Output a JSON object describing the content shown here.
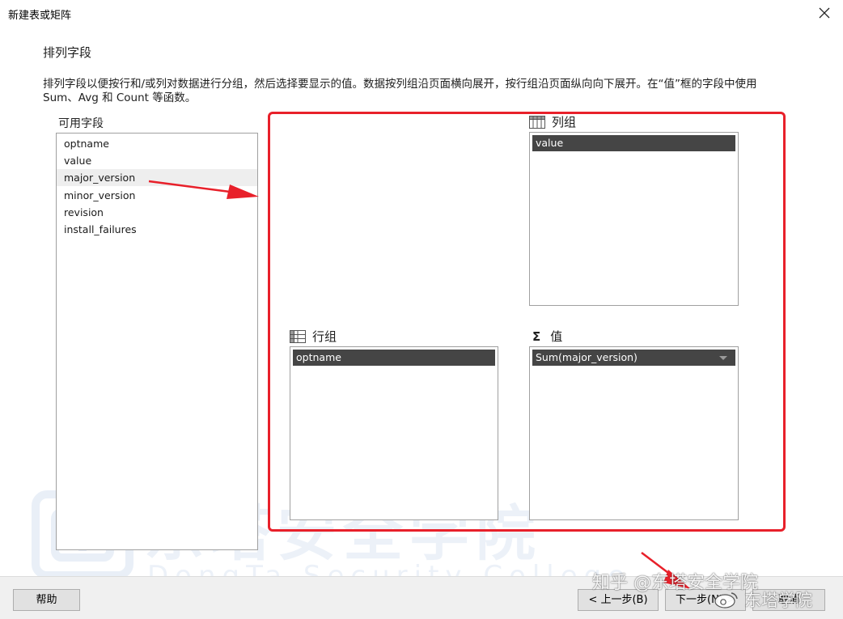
{
  "window": {
    "title": "新建表或矩阵"
  },
  "page": {
    "section_title": "排列字段",
    "description": "排列字段以便按行和/或列对数据进行分组，然后选择要显示的值。数据按列组沿页面横向展开，按行组沿页面纵向向下展开。在“值”框的字段中使用 Sum、Avg 和 Count 等函数。"
  },
  "available_fields": {
    "label": "可用字段",
    "items": [
      "optname",
      "value",
      "major_version",
      "minor_version",
      "revision",
      "install_failures"
    ]
  },
  "column_groups": {
    "label": "列组",
    "items": [
      "value"
    ]
  },
  "row_groups": {
    "label": "行组",
    "items": [
      "optname"
    ]
  },
  "values": {
    "label": "值",
    "symbol": "Σ",
    "items": [
      "Sum(major_version)"
    ]
  },
  "footer": {
    "help_label": "帮助",
    "back_label": "< 上一步(B)",
    "next_label": "下一步(N) >",
    "cancel_label": "取消"
  },
  "watermark": {
    "cn": "东塔安全学院",
    "en": "DongTa Security College",
    "zhihu": "知乎 @东塔安全学院",
    "weibo": "东塔学院"
  },
  "colors": {
    "annotation_red": "#e8202a",
    "chip_bg": "#454545",
    "footer_bg": "#f0f0f0"
  }
}
